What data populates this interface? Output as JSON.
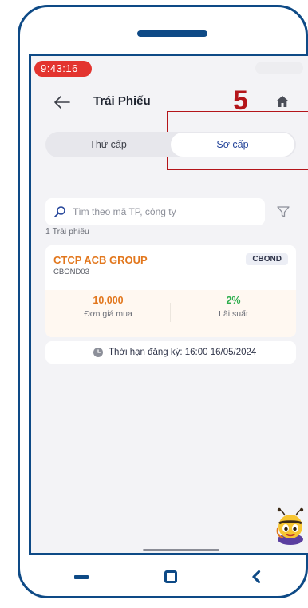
{
  "status_bar": {
    "time": "9:43:16"
  },
  "header": {
    "title": "Trái Phiếu",
    "step_marker": "5"
  },
  "tabs": [
    {
      "label": "Thứ cấp",
      "active": false
    },
    {
      "label": "Sơ cấp",
      "active": true
    }
  ],
  "search": {
    "placeholder": "Tìm theo mã TP, công ty",
    "value": ""
  },
  "results": {
    "count_label": "1 Trái phiếu",
    "items": [
      {
        "company": "CTCP ACB GROUP",
        "code": "CBOND03",
        "type": "CBOND",
        "price": "10,000",
        "price_label": "Đơn giá mua",
        "rate": "2%",
        "rate_label": "Lãi suất",
        "deadline": "Thời hạn đăng ký: 16:00 16/05/2024"
      }
    ]
  },
  "icons": {
    "back": "arrow-left-icon",
    "home": "home-icon",
    "search": "search-icon",
    "filter": "filter-icon",
    "clock": "clock-icon",
    "assistant": "bee-assistant-icon"
  },
  "colors": {
    "frame": "#0e4a86",
    "highlight": "#b4151a",
    "company": "#e2771d",
    "rate": "#2fae4e",
    "tab_active_text": "#27479b",
    "status_pill": "#e3342f"
  }
}
